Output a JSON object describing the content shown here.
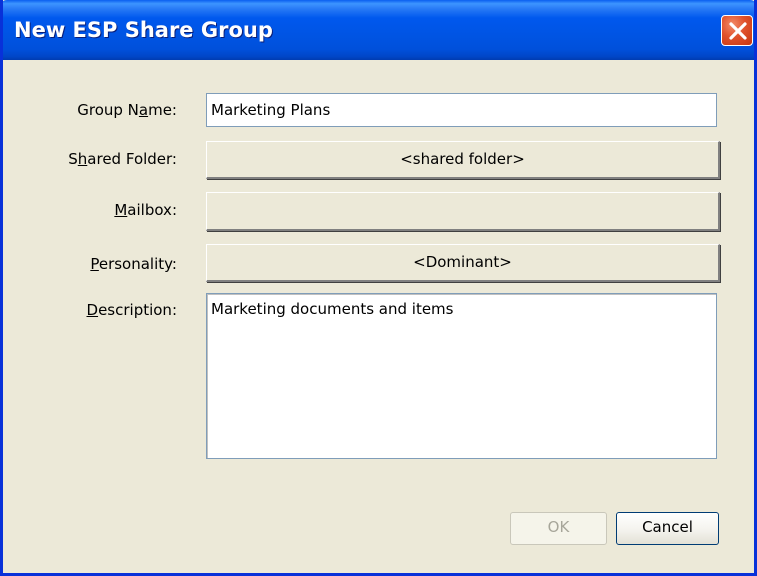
{
  "window": {
    "title": "New ESP Share Group"
  },
  "form": {
    "group_name": {
      "label_pre": "Group N",
      "label_key": "a",
      "label_post": "me:",
      "value": "Marketing Plans"
    },
    "shared_folder": {
      "label_pre": "S",
      "label_key": "h",
      "label_post": "ared Folder:",
      "button_label": "<shared folder>"
    },
    "mailbox": {
      "label_pre": "",
      "label_key": "M",
      "label_post": "ailbox:",
      "button_label": ""
    },
    "personality": {
      "label_pre": "",
      "label_key": "P",
      "label_post": "ersonality:",
      "button_label": "<Dominant>"
    },
    "description": {
      "label_pre": "",
      "label_key": "D",
      "label_post": "escription:",
      "value": "Marketing documents and items"
    }
  },
  "buttons": {
    "ok_label": "OK",
    "cancel_label": "Cancel"
  },
  "colors": {
    "title_bar": "#0054E3",
    "dialog_face": "#ECE9D8",
    "close_button": "#E0512B",
    "disabled_text": "#A7A69A"
  },
  "icons": {
    "close": "close-icon"
  }
}
